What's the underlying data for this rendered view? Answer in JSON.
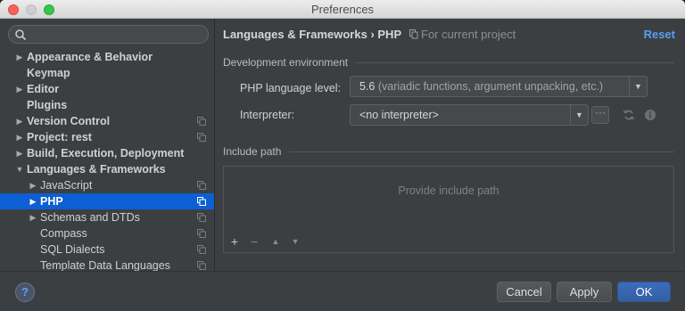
{
  "window": {
    "title": "Preferences"
  },
  "search": {
    "placeholder": ""
  },
  "sidebar": {
    "items": [
      {
        "label": "Appearance & Behavior",
        "arrow": "▶",
        "bold": true,
        "indent": 0,
        "copy": false,
        "selected": false
      },
      {
        "label": "Keymap",
        "arrow": "",
        "bold": true,
        "indent": 0,
        "copy": false,
        "selected": false
      },
      {
        "label": "Editor",
        "arrow": "▶",
        "bold": true,
        "indent": 0,
        "copy": false,
        "selected": false
      },
      {
        "label": "Plugins",
        "arrow": "",
        "bold": true,
        "indent": 0,
        "copy": false,
        "selected": false
      },
      {
        "label": "Version Control",
        "arrow": "▶",
        "bold": true,
        "indent": 0,
        "copy": true,
        "selected": false
      },
      {
        "label": "Project: rest",
        "arrow": "▶",
        "bold": true,
        "indent": 0,
        "copy": true,
        "selected": false
      },
      {
        "label": "Build, Execution, Deployment",
        "arrow": "▶",
        "bold": true,
        "indent": 0,
        "copy": false,
        "selected": false
      },
      {
        "label": "Languages & Frameworks",
        "arrow": "▼",
        "bold": true,
        "indent": 0,
        "copy": false,
        "selected": false
      },
      {
        "label": "JavaScript",
        "arrow": "▶",
        "bold": false,
        "indent": 1,
        "copy": true,
        "selected": false
      },
      {
        "label": "PHP",
        "arrow": "▶",
        "bold": true,
        "indent": 1,
        "copy": true,
        "selected": true
      },
      {
        "label": "Schemas and DTDs",
        "arrow": "▶",
        "bold": false,
        "indent": 1,
        "copy": true,
        "selected": false
      },
      {
        "label": "Compass",
        "arrow": "",
        "bold": false,
        "indent": 1,
        "copy": true,
        "selected": false
      },
      {
        "label": "SQL Dialects",
        "arrow": "",
        "bold": false,
        "indent": 1,
        "copy": true,
        "selected": false
      },
      {
        "label": "Template Data Languages",
        "arrow": "",
        "bold": false,
        "indent": 1,
        "copy": true,
        "selected": false
      }
    ]
  },
  "header": {
    "breadcrumb": "Languages & Frameworks › PHP",
    "scope_note": "For current project",
    "reset_label": "Reset"
  },
  "dev_env": {
    "section_title": "Development environment",
    "php_level_label": "PHP language level:",
    "php_level_version": "5.6",
    "php_level_desc": " (variadic functions, argument unpacking, etc.)",
    "interpreter_label": "Interpreter:",
    "interpreter_value": "<no interpreter>",
    "more_label": "···"
  },
  "include_path": {
    "section_title": "Include path",
    "placeholder": "Provide include path",
    "tools": [
      "+",
      "−",
      "▲",
      "▼"
    ]
  },
  "footer": {
    "help_label": "?",
    "cancel_label": "Cancel",
    "apply_label": "Apply",
    "ok_label": "OK"
  },
  "colors": {
    "selection": "#0d5fd4",
    "link": "#589df6",
    "primary_button": "#3c6cba",
    "panel": "#3c3f41"
  }
}
